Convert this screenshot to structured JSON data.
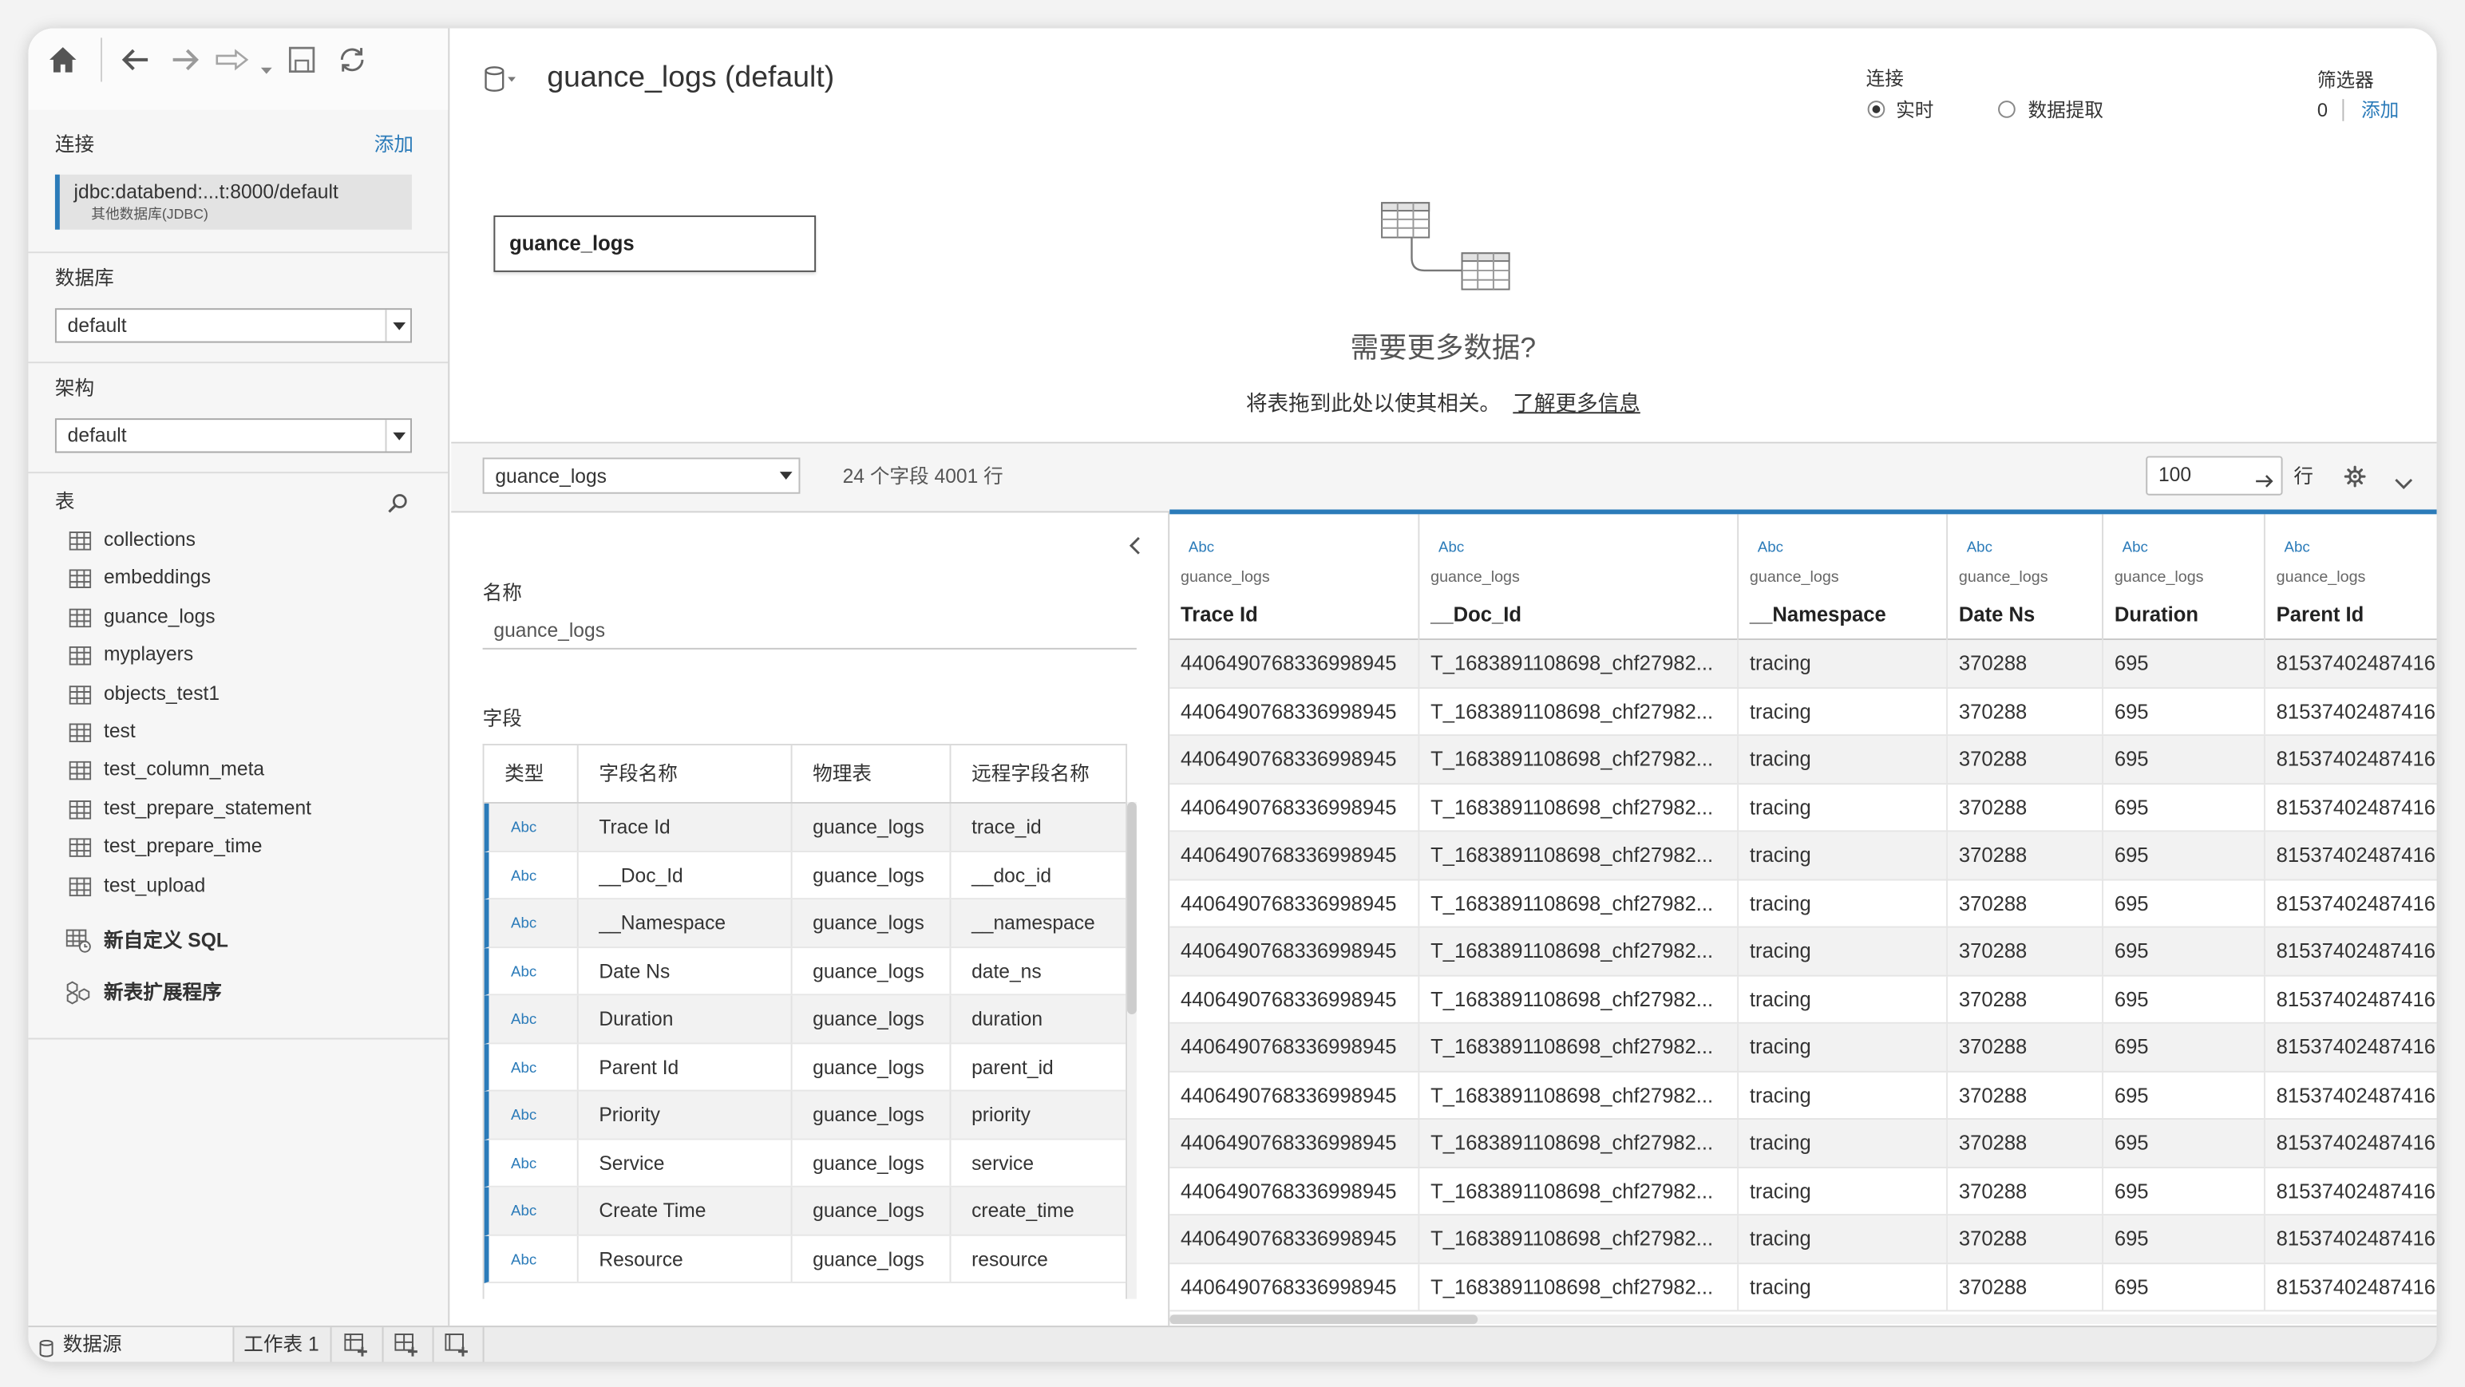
{
  "app": {
    "toolbar_icons": [
      "home-icon",
      "undo-icon",
      "redo-icon",
      "replay-icon",
      "save-icon",
      "refresh-icon"
    ]
  },
  "sidebar": {
    "connection_label": "连接",
    "add_label": "添加",
    "connection": {
      "name": "jdbc:databend:...t:8000/default",
      "type": "其他数据库(JDBC)"
    },
    "database_label": "数据库",
    "database_value": "default",
    "schema_label": "架构",
    "schema_value": "default",
    "tables_label": "表",
    "tables": [
      "collections",
      "embeddings",
      "guance_logs",
      "myplayers",
      "objects_test1",
      "test",
      "test_column_meta",
      "test_prepare_statement",
      "test_prepare_time",
      "test_upload"
    ],
    "custom_sql_label": "新自定义 SQL",
    "extension_label": "新表扩展程序"
  },
  "header": {
    "title": "guance_logs (default)",
    "connection_label": "连接",
    "live_label": "实时",
    "extract_label": "数据提取",
    "connection_mode": "实时",
    "filters_label": "筛选器",
    "filters_count": "0",
    "filters_add": "添加"
  },
  "canvas": {
    "table_name": "guance_logs",
    "prompt_title": "需要更多数据?",
    "prompt_text": "将表拖到此处以使其相关。",
    "learn_more": "了解更多信息"
  },
  "grid_toolbar": {
    "table_select": "guance_logs",
    "summary": "24 个字段 4001 行",
    "rows_value": "100",
    "rows_label": "行"
  },
  "metadata": {
    "name_label": "名称",
    "name_value": "guance_logs",
    "fields_label": "字段",
    "headers": [
      "类型",
      "字段名称",
      "物理表",
      "远程字段名称"
    ],
    "fields": [
      {
        "type": "Abc",
        "name": "Trace Id",
        "table": "guance_logs",
        "remote": "trace_id"
      },
      {
        "type": "Abc",
        "name": "__Doc_Id",
        "table": "guance_logs",
        "remote": "__doc_id"
      },
      {
        "type": "Abc",
        "name": "__Namespace",
        "table": "guance_logs",
        "remote": "__namespace"
      },
      {
        "type": "Abc",
        "name": "Date Ns",
        "table": "guance_logs",
        "remote": "date_ns"
      },
      {
        "type": "Abc",
        "name": "Duration",
        "table": "guance_logs",
        "remote": "duration"
      },
      {
        "type": "Abc",
        "name": "Parent Id",
        "table": "guance_logs",
        "remote": "parent_id"
      },
      {
        "type": "Abc",
        "name": "Priority",
        "table": "guance_logs",
        "remote": "priority"
      },
      {
        "type": "Abc",
        "name": "Service",
        "table": "guance_logs",
        "remote": "service"
      },
      {
        "type": "Abc",
        "name": "Create Time",
        "table": "guance_logs",
        "remote": "create_time"
      },
      {
        "type": "Abc",
        "name": "Resource",
        "table": "guance_logs",
        "remote": "resource"
      }
    ]
  },
  "grid": {
    "columns": [
      {
        "type": "Abc",
        "table": "guance_logs",
        "name": "Trace Id"
      },
      {
        "type": "Abc",
        "table": "guance_logs",
        "name": "__Doc_Id"
      },
      {
        "type": "Abc",
        "table": "guance_logs",
        "name": "__Namespace"
      },
      {
        "type": "Abc",
        "table": "guance_logs",
        "name": "Date Ns"
      },
      {
        "type": "Abc",
        "table": "guance_logs",
        "name": "Duration"
      },
      {
        "type": "Abc",
        "table": "guance_logs",
        "name": "Parent Id"
      }
    ],
    "rows": [
      [
        "4406490768336998945",
        "T_1683891108698_chf27982...",
        "tracing",
        "370288",
        "695",
        "81537402487416"
      ],
      [
        "4406490768336998945",
        "T_1683891108698_chf27982...",
        "tracing",
        "370288",
        "695",
        "81537402487416"
      ],
      [
        "4406490768336998945",
        "T_1683891108698_chf27982...",
        "tracing",
        "370288",
        "695",
        "81537402487416"
      ],
      [
        "4406490768336998945",
        "T_1683891108698_chf27982...",
        "tracing",
        "370288",
        "695",
        "81537402487416"
      ],
      [
        "4406490768336998945",
        "T_1683891108698_chf27982...",
        "tracing",
        "370288",
        "695",
        "81537402487416"
      ],
      [
        "4406490768336998945",
        "T_1683891108698_chf27982...",
        "tracing",
        "370288",
        "695",
        "81537402487416"
      ],
      [
        "4406490768336998945",
        "T_1683891108698_chf27982...",
        "tracing",
        "370288",
        "695",
        "81537402487416"
      ],
      [
        "4406490768336998945",
        "T_1683891108698_chf27982...",
        "tracing",
        "370288",
        "695",
        "81537402487416"
      ],
      [
        "4406490768336998945",
        "T_1683891108698_chf27982...",
        "tracing",
        "370288",
        "695",
        "81537402487416"
      ],
      [
        "4406490768336998945",
        "T_1683891108698_chf27982...",
        "tracing",
        "370288",
        "695",
        "81537402487416"
      ],
      [
        "4406490768336998945",
        "T_1683891108698_chf27982...",
        "tracing",
        "370288",
        "695",
        "81537402487416"
      ],
      [
        "4406490768336998945",
        "T_1683891108698_chf27982...",
        "tracing",
        "370288",
        "695",
        "81537402487416"
      ],
      [
        "4406490768336998945",
        "T_1683891108698_chf27982...",
        "tracing",
        "370288",
        "695",
        "81537402487416"
      ],
      [
        "4406490768336998945",
        "T_1683891108698_chf27982...",
        "tracing",
        "370288",
        "695",
        "81537402487416"
      ]
    ]
  },
  "tabs": {
    "datasource": "数据源",
    "sheet": "工作表 1"
  },
  "colors": {
    "accent": "#2b7bb9",
    "text": "#333333",
    "panel": "#f6f6f6"
  }
}
